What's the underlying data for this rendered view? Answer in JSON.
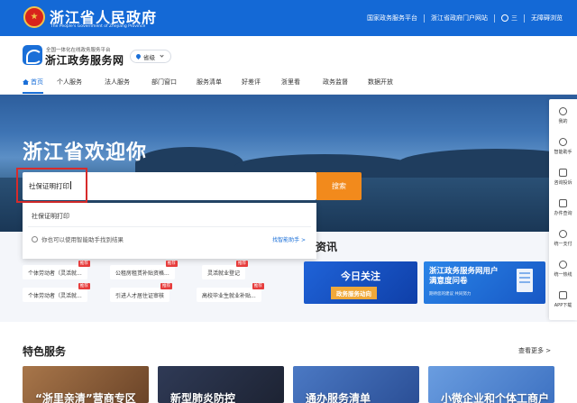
{
  "gov_header": {
    "title": "浙江省人民政府",
    "subtitle": "The People's Government of Zhejiang Province",
    "links": [
      "国家政务服务平台",
      "浙江省政府门户网站"
    ],
    "user": "三",
    "accessibility": "无障碍浏览"
  },
  "site": {
    "small_title": "全国一体化在线政务服务平台",
    "name": "浙江政务服务网",
    "region": "省级"
  },
  "nav": {
    "items": [
      "首页",
      "个人服务",
      "法人服务",
      "部门窗口",
      "服务清单",
      "好差评",
      "浙里看",
      "政务监督",
      "数据开放"
    ]
  },
  "hero": {
    "title": "浙江省欢迎你"
  },
  "search": {
    "value": "社保证明打印",
    "button": "搜索",
    "suggestion": "社保证明打印",
    "tip": "你也可以使用智能助手找到结果",
    "tip_link": "找智能助手 >"
  },
  "news": {
    "title": "资讯"
  },
  "hot_services": [
    {
      "label": "个体劳动者（灵活就...",
      "badge": "推荐"
    },
    {
      "label": "公租房租赁补贴资格...",
      "badge": "推荐"
    },
    {
      "label": "灵活就业登记",
      "badge": "推荐"
    },
    {
      "label": "个体劳动者（灵活就...",
      "badge": "推荐"
    },
    {
      "label": "引进人才居住证审核",
      "badge": "推荐"
    },
    {
      "label": "高校毕业生就业补贴...",
      "badge": "推荐"
    }
  ],
  "banners": {
    "b1_title": "今日关注",
    "b1_sub": "政务服务动向",
    "b2_title": "浙江政务服务网用户满意度问卷",
    "b2_sub": "期待您的建议 共同努力"
  },
  "featured": {
    "title": "特色服务",
    "more": "查看更多 >",
    "cards": [
      "“浙里亲清”营商专区",
      "新型肺炎防控",
      "通办服务清单",
      "小微企业和个体工商户"
    ]
  },
  "sidebar": {
    "items": [
      "我的",
      "智能助手",
      "咨询投诉",
      "办件查询",
      "统一支付",
      "统一热线",
      "APP下载"
    ]
  },
  "colors": {
    "gov_blue": "#1469d6",
    "accent": "#1a6fd8",
    "search_button": "#f28a1c",
    "highlight": "#d72b2b",
    "badge": "#e63c3c"
  }
}
